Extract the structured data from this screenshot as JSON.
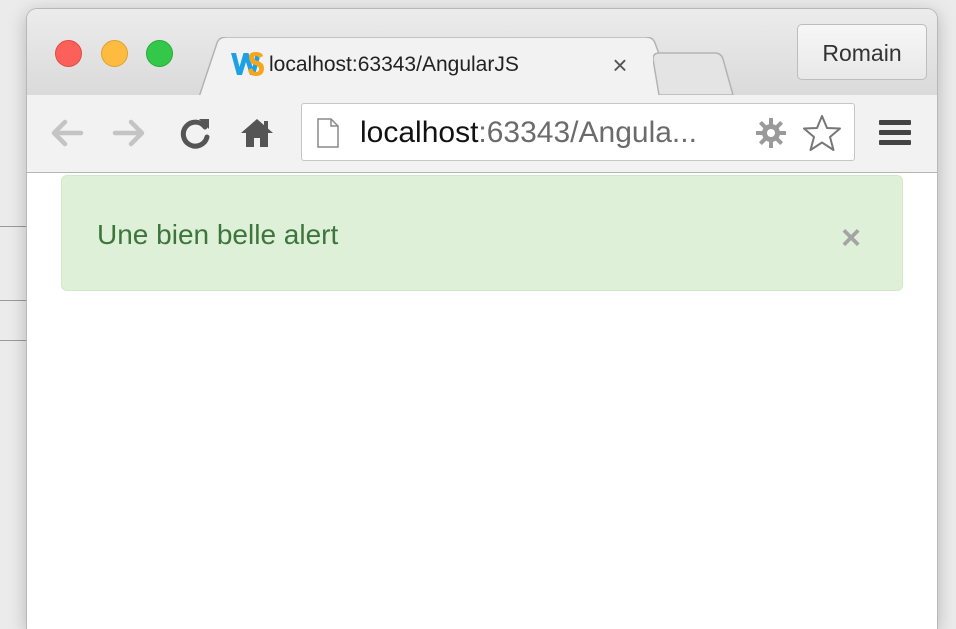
{
  "window": {
    "controls": [
      "close",
      "minimize",
      "zoom"
    ]
  },
  "tab": {
    "favicon": "webstorm-icon",
    "title": "localhost:63343/AngularJS",
    "close_label": "×"
  },
  "profile": {
    "name": "Romain"
  },
  "toolbar": {
    "back_icon": "arrow-left-icon",
    "forward_icon": "arrow-right-icon",
    "reload_icon": "reload-icon",
    "home_icon": "home-icon",
    "menu_icon": "hamburger-menu-icon"
  },
  "omnibox": {
    "url_host": "localhost",
    "url_rest": ":63343/Angula...",
    "page_icon": "page-icon",
    "extension_icon": "extension-gear-icon",
    "bookmark_icon": "star-icon"
  },
  "alert": {
    "message": "Une bien belle alert",
    "close_label": "×",
    "colors": {
      "background": "#dff0d8",
      "text": "#3c763d"
    }
  }
}
